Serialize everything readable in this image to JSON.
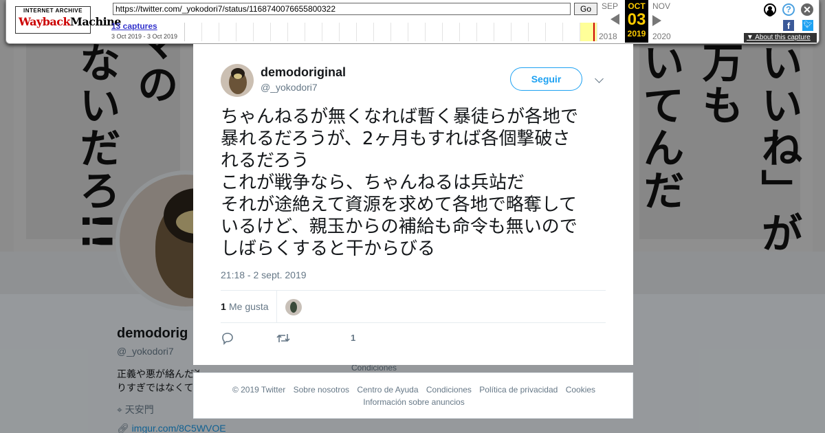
{
  "wayback": {
    "logo_top": "INTERNET ARCHIVE",
    "logo_wayback": "Wayback",
    "logo_machine": "Machine",
    "url": "https://twitter.com/_yokodori7/status/1168740076655800322",
    "go_label": "Go",
    "captures_label": "13 captures",
    "date_range": "3 Oct 2019 - 3 Oct 2019",
    "prev_month": "SEP",
    "prev_year": "2018",
    "current_month": "OCT",
    "current_day": "03",
    "current_year": "2019",
    "next_month": "NOV",
    "next_year": "2020",
    "about_label": "About this capture"
  },
  "profile": {
    "banner_columns": [
      "いいね」が",
      "万も",
      "いてんだ",
      "マの",
      "ないだろ!!"
    ],
    "name": "demodorig",
    "handle": "@_yokodori7",
    "bio": "正義や悪が絡んだ途端、思考が単純にな\nりすぎではなくて",
    "location": "天安門",
    "link": "imgur.com/8C5WVOE",
    "side_link": "Condiciones"
  },
  "tweet": {
    "name": "demodoriginal",
    "handle": "@_yokodori7",
    "follow_label": "Seguir",
    "text_lines": [
      "ちゃんねるが無くなれば暫く暴徒らが各地で",
      "暴れるだろうが、2ヶ月もすれば各個撃破さ",
      "れるだろう",
      "これが戦争なら、ちゃんねるは兵站だ",
      "それが途絶えて資源を求めて各地で略奪して",
      "いるけど、親玉からの補給も命令も無いので",
      "しばらくすると干からびる"
    ],
    "timestamp": "21:18 - 2 sept. 2019",
    "likes_count": "1",
    "likes_label": "Me gusta",
    "action_like_count": "1"
  },
  "footer": {
    "links": [
      "© 2019 Twitter",
      "Sobre nosotros",
      "Centro de Ayuda",
      "Condiciones",
      "Política de privacidad",
      "Cookies"
    ],
    "ads_link": "Información sobre anuncios"
  },
  "colors": {
    "twitter_blue": "#1da1f2",
    "secondary_text": "#657786",
    "wayback_highlight": "#ffcc00"
  }
}
